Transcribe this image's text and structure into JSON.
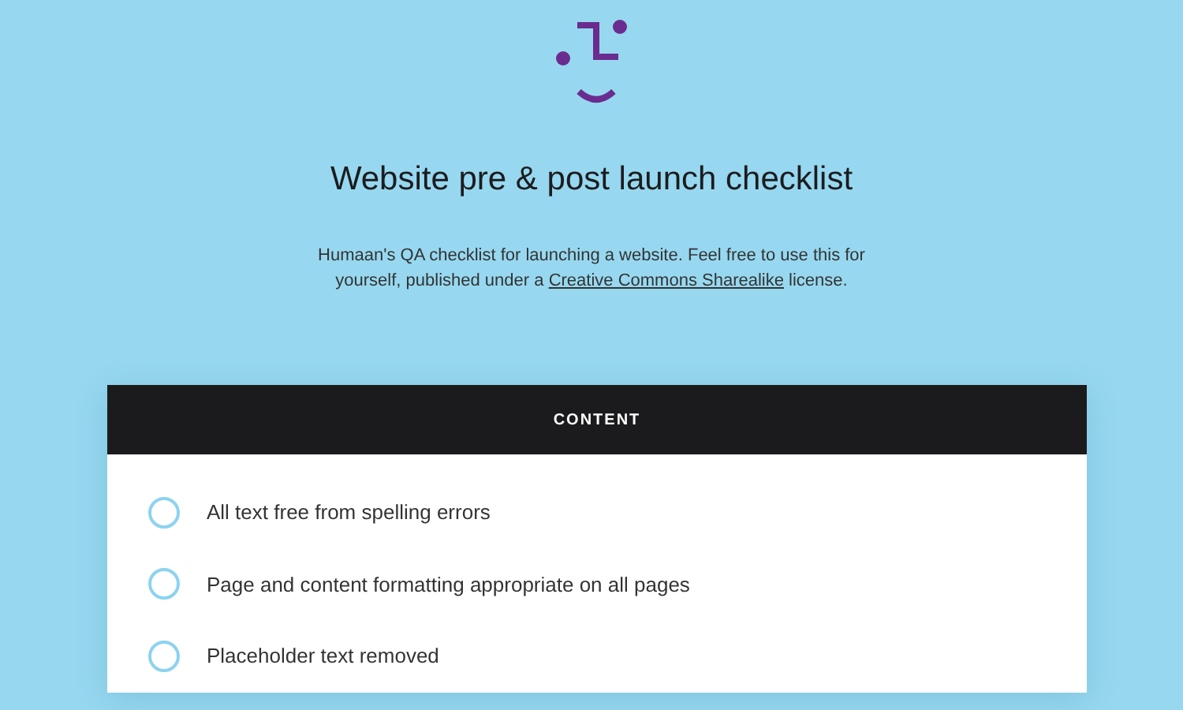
{
  "header": {
    "title": "Website pre & post launch checklist",
    "description": {
      "before": "Humaan's QA checklist for launching a website. Feel free to use this for yourself, published under a ",
      "link": "Creative Commons Sharealike",
      "after": " license."
    }
  },
  "section": {
    "title": "CONTENT",
    "items": [
      {
        "label": "All text free from spelling errors",
        "checked": false
      },
      {
        "label": "Page and content formatting appropriate on all pages",
        "checked": false
      },
      {
        "label": "Placeholder text removed",
        "checked": false
      }
    ]
  }
}
